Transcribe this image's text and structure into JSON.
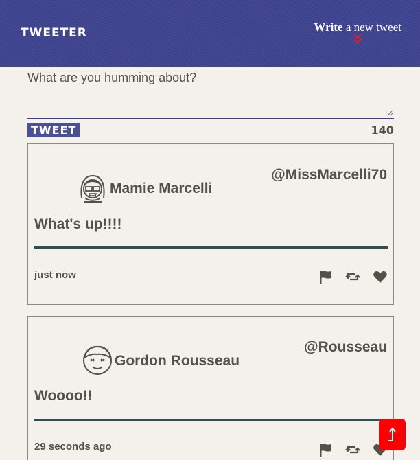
{
  "nav": {
    "brand": "TWEETER",
    "write_bold": "Write",
    "write_rest": " a new tweet"
  },
  "composer": {
    "placeholder": "What are you humming about?",
    "submit_label": "TWEET",
    "counter": "140"
  },
  "tweets": [
    {
      "name": "Mamie Marcelli",
      "handle": "@MissMarcelli70",
      "content": "What's up!!!!",
      "time": "just now"
    },
    {
      "name": "Gordon Rousseau",
      "handle": "@Rousseau",
      "content": "Woooo!!",
      "time": "29 seconds ago"
    }
  ],
  "colors": {
    "nav_bg": "#3f4490",
    "accent": "#4a4f96",
    "page_bg": "#f4f1ec",
    "text": "#545149",
    "divider": "#2a5152",
    "chevron": "#e0212b",
    "scroll_button": "#ff0000"
  },
  "icons": [
    "chevron-double-down-icon",
    "flag-icon",
    "retweet-icon",
    "heart-icon",
    "arrow-up-icon"
  ]
}
